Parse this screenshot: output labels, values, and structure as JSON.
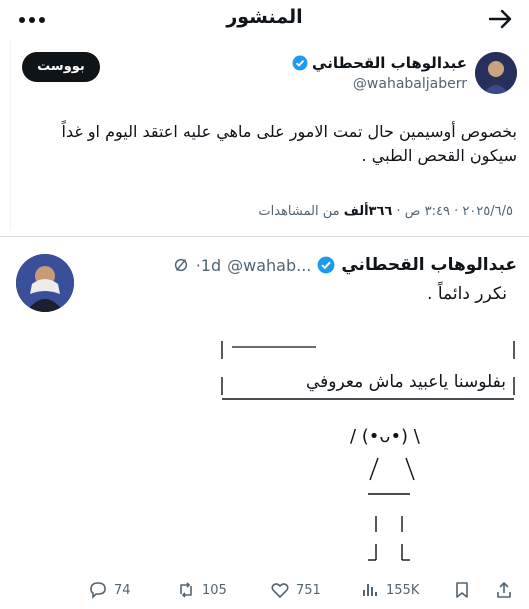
{
  "header": {
    "title": "المنشور",
    "back_icon": "back-arrow-icon",
    "more_icon": "more-dots-icon"
  },
  "post1": {
    "author_name": "عبدالوهاب القحطاني",
    "handle": "@wahabaljaberr",
    "boost_label": "بووست",
    "text": "بخصوص أوسيمين حال تمت الامور على ماهي عليه  اعتقد اليوم او غداً سيكون القحص الطبي .",
    "meta_date": "٢٠٢٥/٦/٥ · ٣:٤٩ ص · ",
    "views_count": "٣٦٦ألف",
    "views_label": " من المشاهدات"
  },
  "post2": {
    "author_name": "عبدالوهاب القحطاني",
    "handle": "@wahab...",
    "time": "·1d",
    "text": "نكرر دائماً .",
    "sign_text": "بفلوسنا ياعبيد ماش معروفي",
    "ascii_face": "/ (•ᴗ•) \\"
  },
  "actions": {
    "replies": "74",
    "reposts": "105",
    "likes": "751",
    "views": "155K"
  },
  "colors": {
    "verified": "#1d9bf0",
    "text_primary": "#0f1419",
    "text_secondary": "#536471"
  }
}
